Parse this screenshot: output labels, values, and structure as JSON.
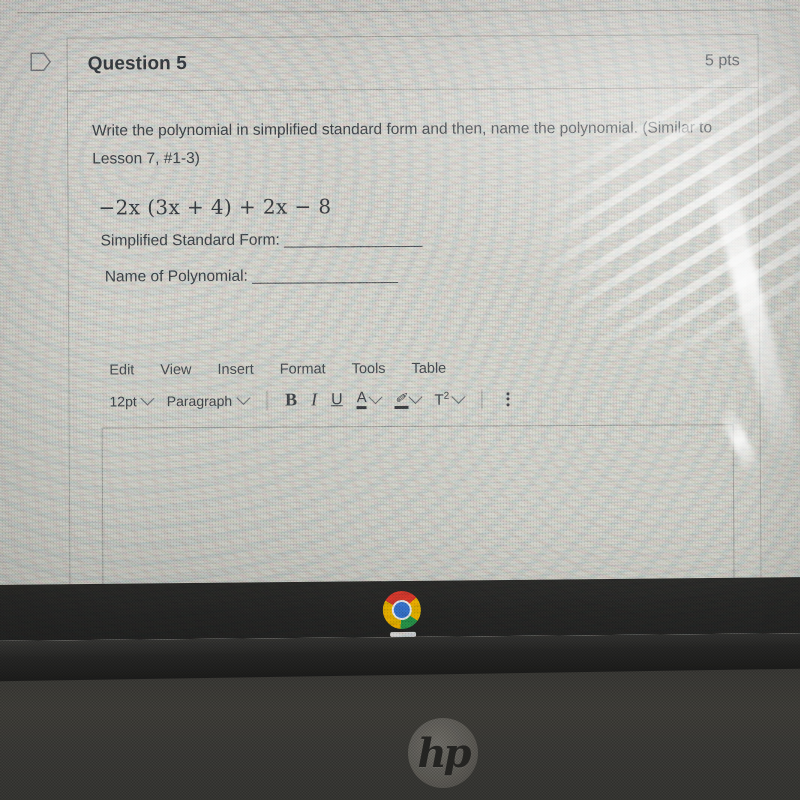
{
  "question": {
    "flag_icon": "flag-outline-icon",
    "title": "Question 5",
    "points": "5 pts",
    "prompt": "Write the polynomial in simplified standard form and then, name the polynomial. (Similar to Lesson 7, #1-3)",
    "expression": "−2x (3x + 4) + 2x − 8",
    "blanks": [
      {
        "label": "Simplified Standard Form:",
        "rule": "__________________"
      },
      {
        "label": "Name of Polynomial:",
        "rule": "___________________"
      }
    ]
  },
  "editor": {
    "menu": [
      "Edit",
      "View",
      "Insert",
      "Format",
      "Tools",
      "Table"
    ],
    "font_size": "12pt",
    "block_format": "Paragraph",
    "bold_label": "B",
    "italic_label": "I",
    "underline_label": "U",
    "text_color_label": "A",
    "highlight_label": "✐",
    "superscript_label": "T",
    "superscript_exponent": "2",
    "more_options": "more-options",
    "body_value": "",
    "body_placeholder": ""
  },
  "taskbar": {
    "chrome_label": "Google Chrome"
  },
  "device": {
    "brand": "hp"
  },
  "colors": {
    "screen_bg": "#dad9d3",
    "card_border": "#b0b0aa",
    "text": "#41464b",
    "chrome_red": "#ea3e30",
    "chrome_yellow": "#fcc000",
    "chrome_green": "#2aa14f",
    "chrome_blue": "#3b7ddd"
  }
}
